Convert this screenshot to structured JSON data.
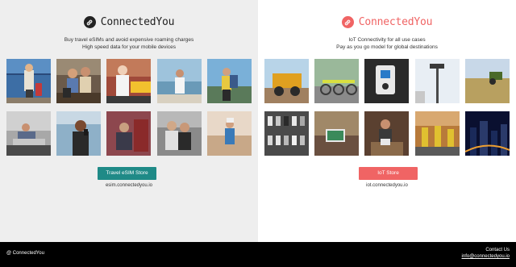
{
  "colors": {
    "left_bg": "#eeeeee",
    "right_bg": "#ffffff",
    "left_accent": "#1f8a87",
    "right_accent": "#f06464",
    "left_brand_text": "#222222",
    "right_brand_text": "#f06464",
    "footer_bg": "#000000"
  },
  "left": {
    "brand_name": "ConnectedYou",
    "brand_icon": "link-icon",
    "tagline_line1": "Buy travel eSIMs and avoid expensive roaming charges",
    "tagline_line2": "High speed data for your mobile devices",
    "button_label": "Travel eSIM Store",
    "domain": "esim.connectedyou.io"
  },
  "right": {
    "brand_name": "ConnectedYou",
    "brand_icon": "link-icon",
    "tagline_line1": "IoT Connectivity for all use cases",
    "tagline_line2": "Pay as you go model for global destinations",
    "button_label": "IoT Store",
    "domain": "iot.connectedyou.io"
  },
  "footer": {
    "copyright": "@ ConnectedYou",
    "contact_label": "Contact Us",
    "contact_email": "info@connectedyou.io"
  }
}
